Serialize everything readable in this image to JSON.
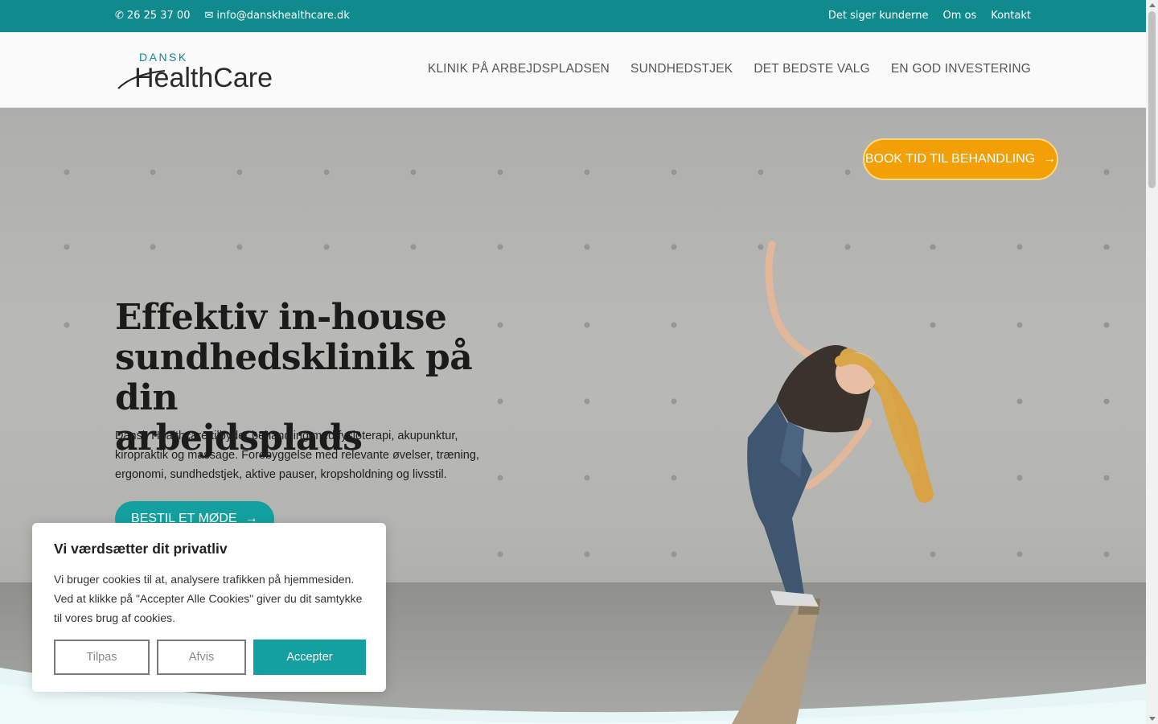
{
  "topbar": {
    "phone": "26 25 37 00",
    "email": "info@danskhealthcare.dk",
    "links": [
      "Det siger kunderne",
      "Om os",
      "Kontakt"
    ]
  },
  "header": {
    "logo_small": "DANSK",
    "logo_main": "HealthCare",
    "nav": [
      "KLINIK PÅ ARBEJDSPLADSEN",
      "SUNDHEDSTJEK",
      "DET BEDSTE VALG",
      "EN GOD INVESTERING"
    ]
  },
  "hero": {
    "title_line1": "Effektiv in-house",
    "title_line2": "sundhedsklinik på din",
    "title_line3": "arbejdsplads",
    "text": "Dansk Healthcare tilbyder behandling med fysioterapi, akupunktur, kiropraktik og massage. Forebyggelse med relevante øvelser, træning, ergonomi, sundhedstjek, aktive pauser, kropsholdning og livsstil.",
    "cta_meet": "BESTIL ET MØDE",
    "cta_book": "BOOK TID TIL BEHANDLING",
    "arrow": "→"
  },
  "cookie": {
    "title": "Vi værdsætter dit privatliv",
    "text": "Vi bruger cookies til at, analysere trafikken på hjemmesiden. Ved at klikke på \"Accepter Alle Cookies\" giver du dit samtykke til vores brug af cookies.",
    "customize": "Tilpas",
    "reject": "Afvis",
    "accept": "Accepter"
  },
  "colors": {
    "teal": "#0f8b8d",
    "accent_teal": "#14a0a0",
    "orange": "#f3a007"
  }
}
